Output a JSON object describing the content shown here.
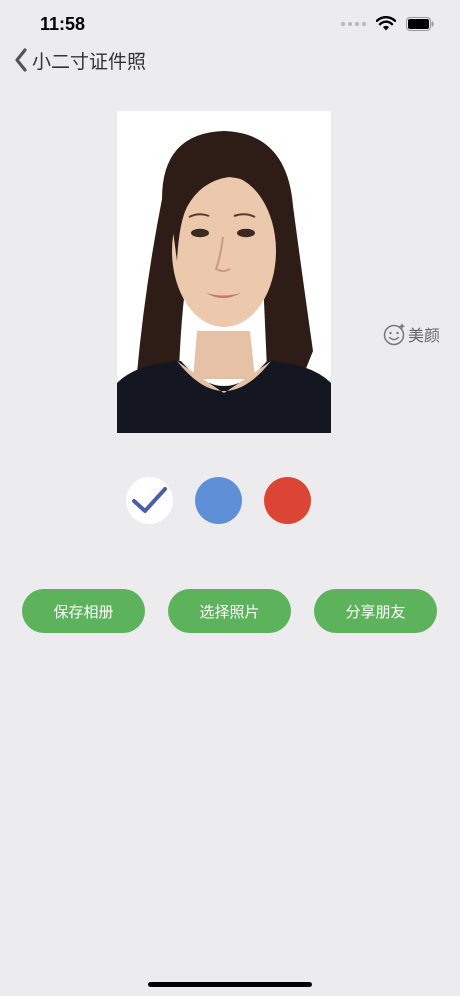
{
  "status_bar": {
    "time": "11:58"
  },
  "nav": {
    "title": "小二寸证件照"
  },
  "beauty": {
    "label": "美颜"
  },
  "background_options": [
    {
      "name": "white",
      "color": "#ffffff",
      "selected": true
    },
    {
      "name": "blue",
      "color": "#5f8fd6",
      "selected": false
    },
    {
      "name": "red",
      "color": "#dc4535",
      "selected": false
    }
  ],
  "actions": {
    "save_label": "保存相册",
    "choose_label": "选择照片",
    "share_label": "分享朋友"
  },
  "colors": {
    "accent_green": "#5db35b",
    "background": "#ececef"
  }
}
